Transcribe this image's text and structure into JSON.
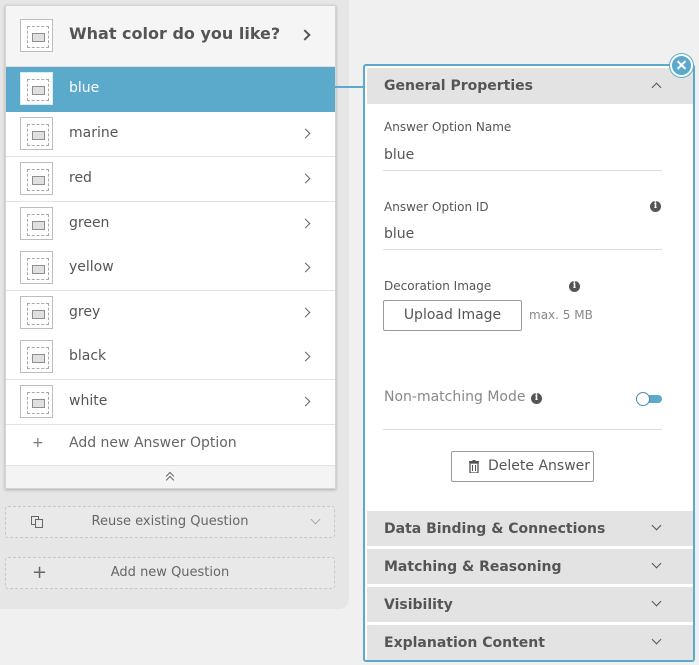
{
  "question": {
    "title": "What color do you like?"
  },
  "answer_options": [
    {
      "label": "blue",
      "selected": true
    },
    {
      "label": "marine",
      "selected": false
    },
    {
      "label": "red",
      "selected": false
    },
    {
      "label": "green",
      "selected": false
    },
    {
      "label": "yellow",
      "selected": false
    },
    {
      "label": "grey",
      "selected": false
    },
    {
      "label": "black",
      "selected": false
    },
    {
      "label": "white",
      "selected": false
    }
  ],
  "add_answer_option_label": "Add new Answer Option",
  "reuse_question_label": "Reuse existing Question",
  "add_question_label": "Add new Question",
  "panel": {
    "general_properties_title": "General Properties",
    "answer_option_name_label": "Answer Option Name",
    "answer_option_name_value": "blue",
    "answer_option_id_label": "Answer Option ID",
    "answer_option_id_value": "blue",
    "decoration_image_label": "Decoration Image",
    "upload_image_label": "Upload Image",
    "max_size_text": "max. 5 MB",
    "non_matching_mode_label": "Non-matching Mode",
    "non_matching_mode_on": false,
    "delete_answer_label": "Delete Answer",
    "sections": [
      "Data Binding & Connections",
      "Matching & Reasoning",
      "Visibility",
      "Explanation Content"
    ]
  },
  "colors": {
    "accent": "#5ba9cb",
    "section_header": "#e3e3e3",
    "left_background": "#e6e6e6"
  }
}
